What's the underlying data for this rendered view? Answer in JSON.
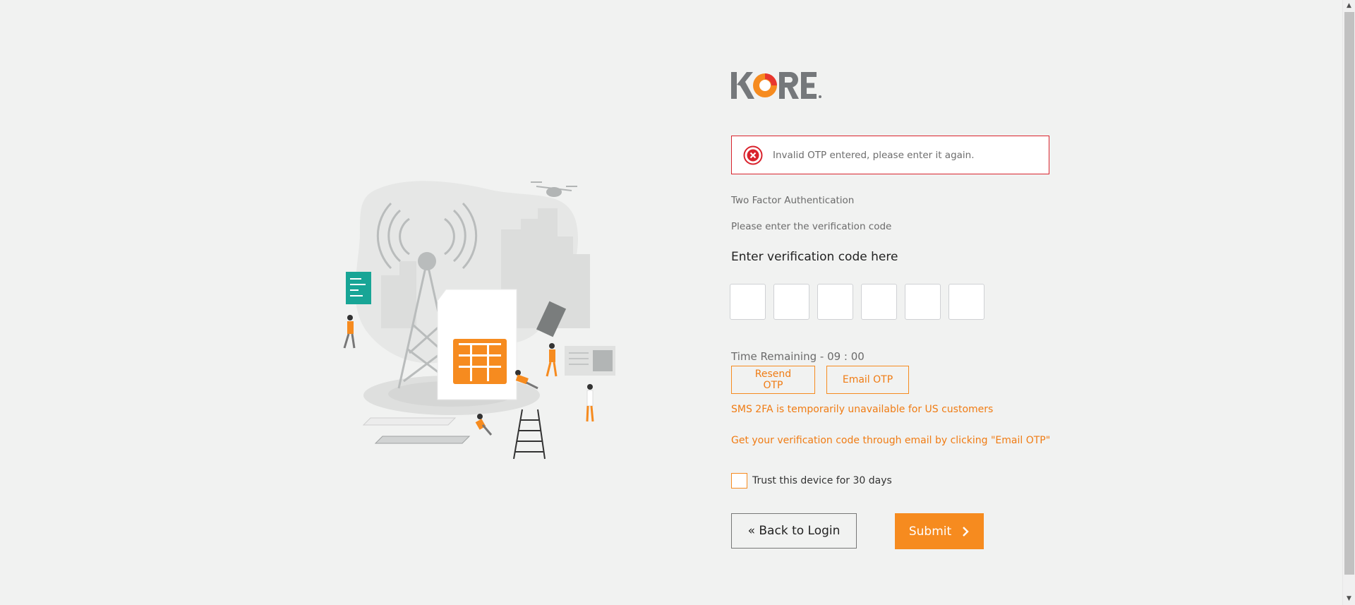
{
  "brand": {
    "name": "KORE",
    "accent": "#f68b1f",
    "error_color": "#d9232d"
  },
  "alert": {
    "icon": "error-x-icon",
    "message": "Invalid OTP entered, please enter it again."
  },
  "page": {
    "heading": "Two Factor Authentication",
    "instruction": "Please enter the verification code",
    "code_label": "Enter verification code here"
  },
  "code_inputs": [
    "",
    "",
    "",
    "",
    "",
    ""
  ],
  "timer": {
    "text": "Time Remaining - 09 : 00"
  },
  "otp": {
    "resend_label": "Resend OTP",
    "email_label": "Email OTP"
  },
  "notices": {
    "sms": "SMS 2FA is temporarily unavailable for US customers",
    "email": "Get your verification code through email by clicking \"Email OTP\""
  },
  "trust": {
    "label": "Trust this device for 30 days",
    "checked": false
  },
  "actions": {
    "back_label": "« Back to Login",
    "submit_label": "Submit",
    "submit_icon": "chevron-right-icon"
  }
}
